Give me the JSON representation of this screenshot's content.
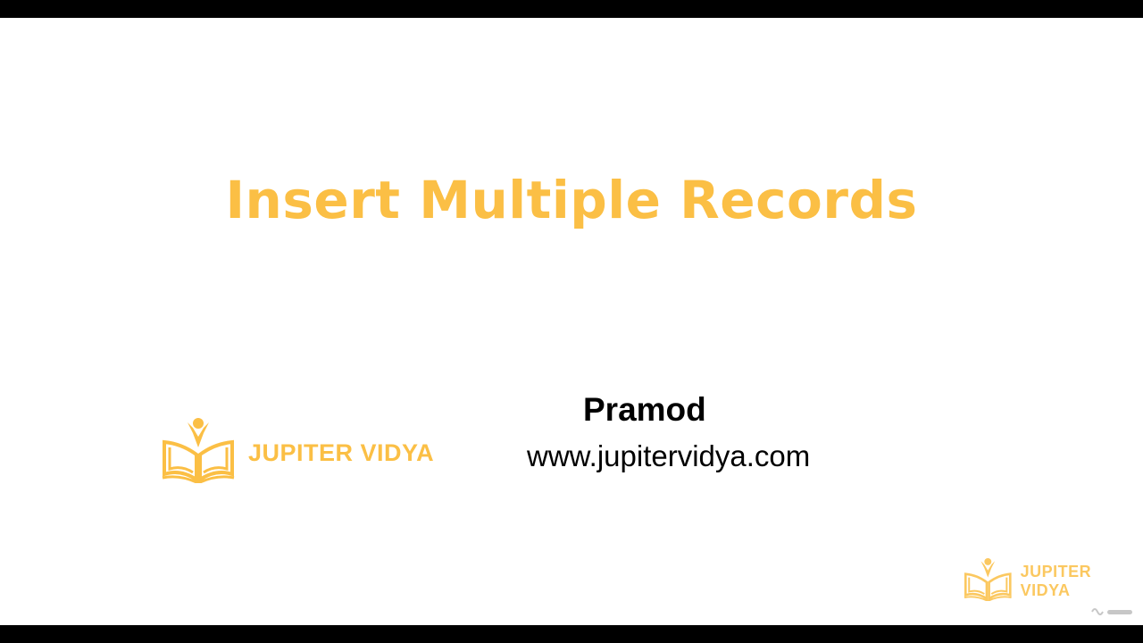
{
  "slide": {
    "title": "Insert Multiple Records",
    "author": "Pramod",
    "website": "www.jupitervidya.com"
  },
  "brand": {
    "name": "JUPITER VIDYA",
    "color": "#fbbf45",
    "icon": "book-person-logo-icon"
  },
  "watermark": {
    "name": "JUPITER VIDYA"
  }
}
